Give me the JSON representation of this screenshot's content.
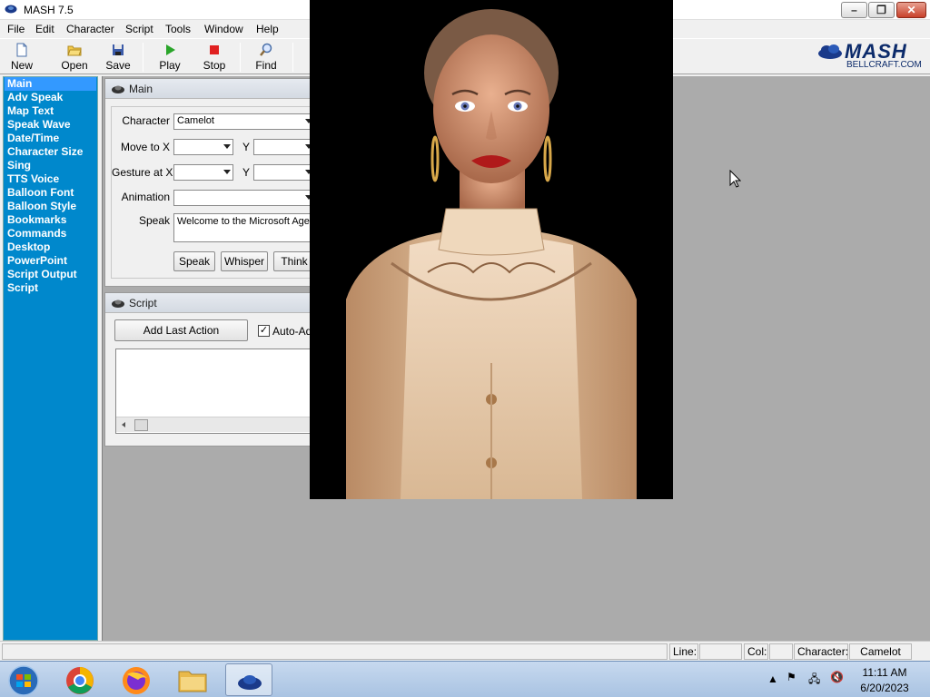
{
  "window": {
    "title": "MASH 7.5"
  },
  "menu": [
    "File",
    "Edit",
    "Character",
    "Script",
    "Tools",
    "Window",
    "Help"
  ],
  "toolbar": {
    "new": "New",
    "open": "Open",
    "save": "Save",
    "play": "Play",
    "stop": "Stop",
    "find": "Find"
  },
  "logo": {
    "name": "MASH",
    "site": "BELLCRAFT.COM"
  },
  "sidebar": {
    "items": [
      "Main",
      "Adv Speak",
      "Map Text",
      "Speak Wave",
      "Date/Time",
      "Character Size",
      "Sing",
      "TTS Voice",
      "Balloon Font",
      "Balloon Style",
      "Bookmarks",
      "Commands",
      "Desktop",
      "PowerPoint",
      "Script Output",
      "Script"
    ],
    "active_index": 0
  },
  "main_panel": {
    "title": "Main",
    "character_label": "Character",
    "character_value": "Camelot",
    "move_to_label": "Move to X",
    "gesture_at_label": "Gesture at X",
    "y_label": "Y",
    "animation_label": "Animation",
    "speak_label": "Speak",
    "speak_text": "Welcome to the Microsoft Agen",
    "speak_button": "Speak",
    "whisper_button": "Whisper",
    "think_button": "Think"
  },
  "script_panel": {
    "title": "Script",
    "add_last_action": "Add Last Action",
    "auto_add_label": "Auto-Add",
    "auto_add_checked": "✓"
  },
  "statusbar": {
    "line_label": "Line:",
    "col_label": "Col:",
    "character_label": "Character:",
    "character_value": "Camelot"
  },
  "taskbar": {
    "time": "11:11 AM",
    "date": "6/20/2023"
  },
  "colors": {
    "sidebar_bg": "#0088cc",
    "sidebar_active": "#3399ff",
    "workspace_bg": "#ababab"
  }
}
